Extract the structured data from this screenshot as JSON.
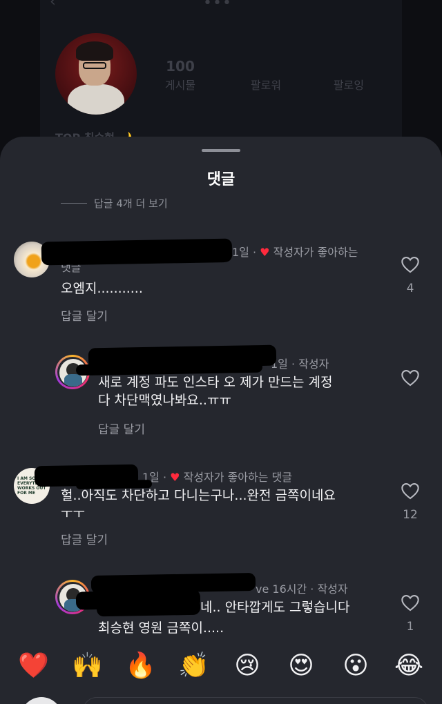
{
  "profile": {
    "stats": [
      {
        "value": "100",
        "label": "게시물"
      },
      {
        "value": "",
        "label": "팔로워"
      },
      {
        "value": "",
        "label": "팔로잉"
      }
    ],
    "name": "TOP 최승현 🌙"
  },
  "sheet": {
    "title": "댓글",
    "more_replies": "답글 4개 더 보기"
  },
  "comments": [
    {
      "meta": "1일 · ",
      "liked_by_author": "작성자가 좋아하는",
      "meta_wrap": "댓글",
      "text": "오엠지...........",
      "reply": "답글 달기",
      "likes": "4",
      "avatar": "egg-photo"
    },
    {
      "meta": "1일 · 작성자",
      "text_line1": "새로 계정 파도 인스타 오 제가 만드는 계정",
      "text_line2": "다 차단맥였나봐요..ㅠㅠ",
      "reply": "답글 달기",
      "likes": "",
      "avatar": "cartoon-kid"
    },
    {
      "meta": "1일 · ",
      "liked_by_author": "작성자가 좋아하는 댓글",
      "text_line1": "헐..아직도 차단하고 다니는구나...완전 금쪽이네요",
      "text_line2": "ㅜㅜ",
      "reply": "답글 달기",
      "likes": "12",
      "avatar_text": "I AM SO EVERYTHING WORKS OUT FOR ME"
    },
    {
      "meta_prefix": "ve",
      "meta": "16시간 · 작성자",
      "text_line1": "네.. 안타깝게도 그렇습니다",
      "text_line2": "최승현 영원 금쪽이.....",
      "likes": "1",
      "avatar": "cartoon-kid"
    }
  ],
  "emoji_bar": [
    "❤️",
    "🙌",
    "🔥",
    "👏",
    "😢",
    "😍",
    "😮",
    "😂"
  ],
  "colors": {
    "sheet_bg": "#25272e",
    "heart_red": "#ff2a3d",
    "muted_text": "#9a9ca4"
  }
}
